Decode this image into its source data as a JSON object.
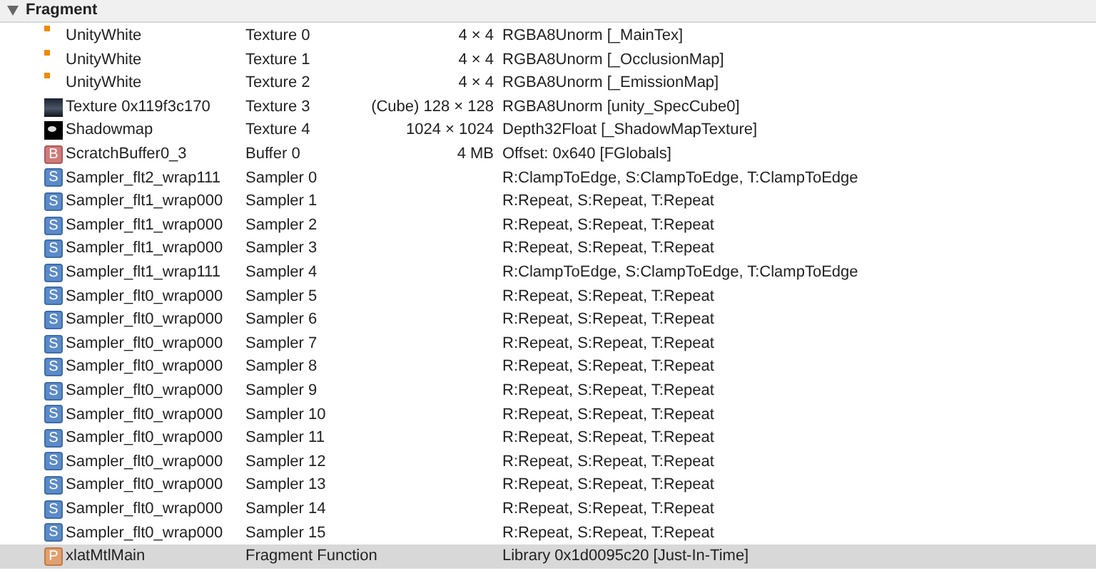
{
  "section": {
    "title": "Fragment",
    "expanded": true
  },
  "rows": [
    {
      "kind": "dot",
      "name": "UnityWhite",
      "binding": "Texture 0",
      "size": "4 × 4",
      "info": "RGBA8Unorm [_MainTex]",
      "selected": false
    },
    {
      "kind": "dot",
      "name": "UnityWhite",
      "binding": "Texture 1",
      "size": "4 × 4",
      "info": "RGBA8Unorm [_OcclusionMap]",
      "selected": false
    },
    {
      "kind": "dot",
      "name": "UnityWhite",
      "binding": "Texture 2",
      "size": "4 × 4",
      "info": "RGBA8Unorm [_EmissionMap]",
      "selected": false
    },
    {
      "kind": "cube",
      "name": "Texture 0x119f3c170",
      "binding": "Texture 3",
      "size": "(Cube) 128 × 128",
      "info": "RGBA8Unorm [unity_SpecCube0]",
      "selected": false
    },
    {
      "kind": "shadow",
      "name": "Shadowmap",
      "binding": "Texture 4",
      "size": "1024 × 1024",
      "info": "Depth32Float [_ShadowMapTexture]",
      "selected": false
    },
    {
      "kind": "buffer",
      "letter": "B",
      "name": "ScratchBuffer0_3",
      "binding": "Buffer 0",
      "size": "4 MB",
      "info": "Offset: 0x640 [FGlobals]",
      "selected": false
    },
    {
      "kind": "sampler",
      "letter": "S",
      "name": "Sampler_flt2_wrap111",
      "binding": "Sampler 0",
      "info": "R:ClampToEdge, S:ClampToEdge, T:ClampToEdge",
      "selected": false
    },
    {
      "kind": "sampler",
      "letter": "S",
      "name": "Sampler_flt1_wrap000",
      "binding": "Sampler 1",
      "info": "R:Repeat, S:Repeat, T:Repeat",
      "selected": false
    },
    {
      "kind": "sampler",
      "letter": "S",
      "name": "Sampler_flt1_wrap000",
      "binding": "Sampler 2",
      "info": "R:Repeat, S:Repeat, T:Repeat",
      "selected": false
    },
    {
      "kind": "sampler",
      "letter": "S",
      "name": "Sampler_flt1_wrap000",
      "binding": "Sampler 3",
      "info": "R:Repeat, S:Repeat, T:Repeat",
      "selected": false
    },
    {
      "kind": "sampler",
      "letter": "S",
      "name": "Sampler_flt1_wrap111",
      "binding": "Sampler 4",
      "info": "R:ClampToEdge, S:ClampToEdge, T:ClampToEdge",
      "selected": false
    },
    {
      "kind": "sampler",
      "letter": "S",
      "name": "Sampler_flt0_wrap000",
      "binding": "Sampler 5",
      "info": "R:Repeat, S:Repeat, T:Repeat",
      "selected": false
    },
    {
      "kind": "sampler",
      "letter": "S",
      "name": "Sampler_flt0_wrap000",
      "binding": "Sampler 6",
      "info": "R:Repeat, S:Repeat, T:Repeat",
      "selected": false
    },
    {
      "kind": "sampler",
      "letter": "S",
      "name": "Sampler_flt0_wrap000",
      "binding": "Sampler 7",
      "info": "R:Repeat, S:Repeat, T:Repeat",
      "selected": false
    },
    {
      "kind": "sampler",
      "letter": "S",
      "name": "Sampler_flt0_wrap000",
      "binding": "Sampler 8",
      "info": "R:Repeat, S:Repeat, T:Repeat",
      "selected": false
    },
    {
      "kind": "sampler",
      "letter": "S",
      "name": "Sampler_flt0_wrap000",
      "binding": "Sampler 9",
      "info": "R:Repeat, S:Repeat, T:Repeat",
      "selected": false
    },
    {
      "kind": "sampler",
      "letter": "S",
      "name": "Sampler_flt0_wrap000",
      "binding": "Sampler 10",
      "info": "R:Repeat, S:Repeat, T:Repeat",
      "selected": false
    },
    {
      "kind": "sampler",
      "letter": "S",
      "name": "Sampler_flt0_wrap000",
      "binding": "Sampler 11",
      "info": "R:Repeat, S:Repeat, T:Repeat",
      "selected": false
    },
    {
      "kind": "sampler",
      "letter": "S",
      "name": "Sampler_flt0_wrap000",
      "binding": "Sampler 12",
      "info": "R:Repeat, S:Repeat, T:Repeat",
      "selected": false
    },
    {
      "kind": "sampler",
      "letter": "S",
      "name": "Sampler_flt0_wrap000",
      "binding": "Sampler 13",
      "info": "R:Repeat, S:Repeat, T:Repeat",
      "selected": false
    },
    {
      "kind": "sampler",
      "letter": "S",
      "name": "Sampler_flt0_wrap000",
      "binding": "Sampler 14",
      "info": "R:Repeat, S:Repeat, T:Repeat",
      "selected": false
    },
    {
      "kind": "sampler",
      "letter": "S",
      "name": "Sampler_flt0_wrap000",
      "binding": "Sampler 15",
      "info": "R:Repeat, S:Repeat, T:Repeat",
      "selected": false
    },
    {
      "kind": "function",
      "letter": "P",
      "name": "xlatMtlMain",
      "binding": "Fragment Function",
      "info": "Library 0x1d0095c20 [Just-In-Time]",
      "selected": true
    }
  ]
}
